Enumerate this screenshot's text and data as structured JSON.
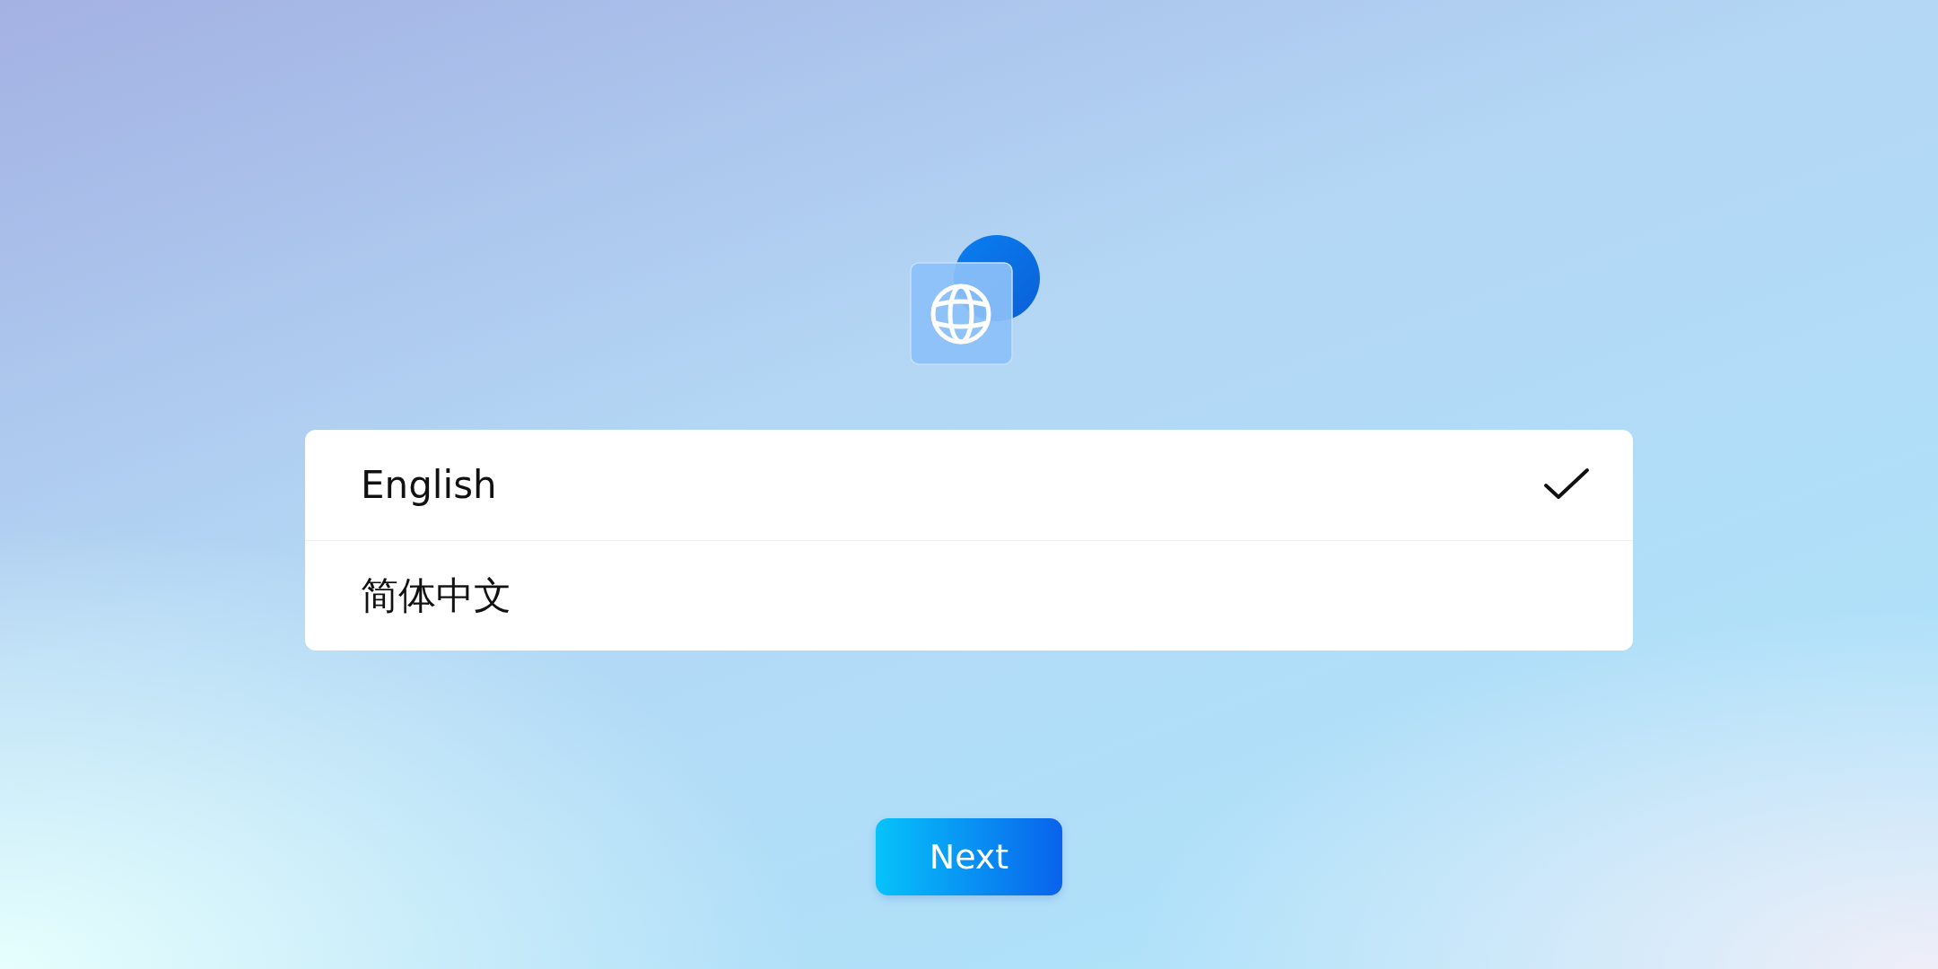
{
  "languages": [
    {
      "label": "English",
      "selected": true
    },
    {
      "label": "简体中文",
      "selected": false
    }
  ],
  "next_button": {
    "label": "Next"
  }
}
